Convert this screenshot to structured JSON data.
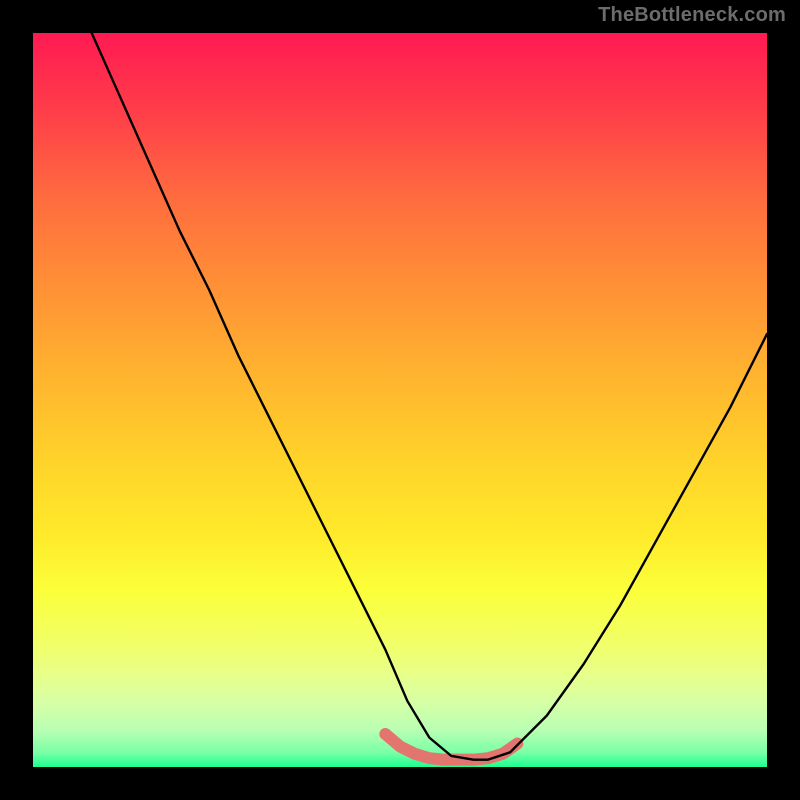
{
  "watermark": "TheBottleneck.com",
  "colors": {
    "frame": "#000000",
    "curve": "#000000",
    "highlight": "#e2766f",
    "gradient_stops": [
      "#ff1a52",
      "#ff3b4a",
      "#ff6a3f",
      "#ff8f36",
      "#ffb22f",
      "#ffd22a",
      "#ffe92a",
      "#fbff3a",
      "#f3ff60",
      "#e9ff86",
      "#d8ffa5",
      "#b8ffb4",
      "#7affa6",
      "#1cff93"
    ]
  },
  "chart_data": {
    "type": "line",
    "title": "",
    "xlabel": "",
    "ylabel": "",
    "xlim": [
      0,
      100
    ],
    "ylim": [
      0,
      100
    ],
    "grid": false,
    "legend": false,
    "series": [
      {
        "name": "curve",
        "x": [
          8,
          12,
          16,
          20,
          24,
          28,
          32,
          36,
          40,
          44,
          48,
          51,
          54,
          57,
          60,
          62,
          65,
          70,
          75,
          80,
          85,
          90,
          95,
          100
        ],
        "y": [
          100,
          91,
          82,
          73,
          65,
          56,
          48,
          40,
          32,
          24,
          16,
          9,
          4,
          1.5,
          1,
          1,
          2,
          7,
          14,
          22,
          31,
          40,
          49,
          59
        ]
      },
      {
        "name": "highlight-band",
        "x": [
          48,
          50,
          52,
          54,
          56,
          58,
          60,
          62,
          64,
          66
        ],
        "y": [
          4.5,
          2.8,
          1.8,
          1.2,
          1.0,
          1.0,
          1.0,
          1.2,
          1.8,
          3.2
        ]
      }
    ],
    "annotations": []
  }
}
